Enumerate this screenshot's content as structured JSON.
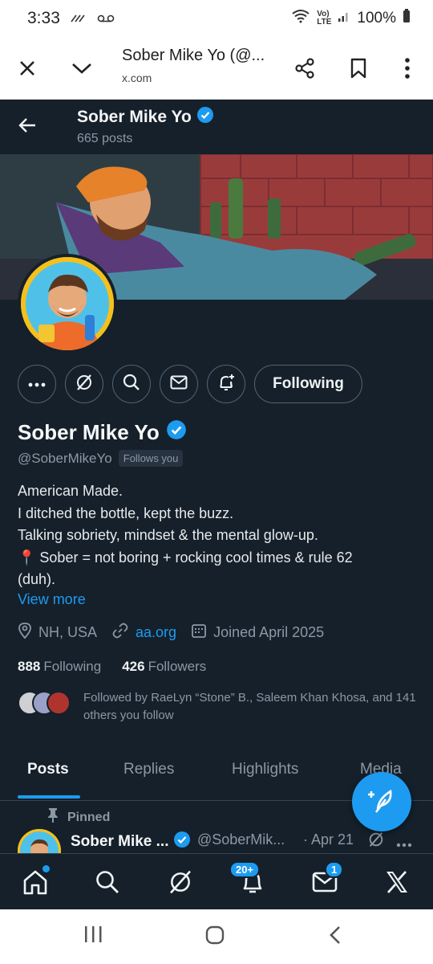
{
  "status_bar": {
    "time": "3:33",
    "battery": "100%"
  },
  "browser": {
    "title": "Sober Mike Yo (@...",
    "domain": "x.com"
  },
  "header": {
    "name": "Sober Mike Yo",
    "posts": "665 posts"
  },
  "profile": {
    "display_name": "Sober Mike Yo",
    "handle": "@SoberMikeYo",
    "follows_you": "Follows you",
    "following_button": "Following",
    "bio": [
      "American Made.",
      "I ditched the bottle, kept the buzz.",
      "Talking sobriety, mindset & the mental glow-up.",
      "📍 Sober = not boring + rocking cool times & rule 62",
      "(duh)."
    ],
    "view_more": "View more",
    "location": "NH, USA",
    "website": "aa.org",
    "joined": "Joined April 2025",
    "following_count": "888",
    "following_label": "Following",
    "followers_count": "426",
    "followers_label": "Followers",
    "followed_by": "Followed by RaeLyn “Stone” B., Saleem Khan Khosa, and 141 others you follow"
  },
  "tabs": [
    "Posts",
    "Replies",
    "Highlights",
    "Media"
  ],
  "pinned": {
    "label": "Pinned",
    "name": "Sober Mike ...",
    "handle": "@SoberMik...",
    "time": "· Apr 21"
  },
  "bottom_nav": {
    "notifications_badge": "20+",
    "messages_badge": "1"
  },
  "colors": {
    "background": "#15202b",
    "accent": "#1d9bf0",
    "muted": "#8b98a5"
  }
}
